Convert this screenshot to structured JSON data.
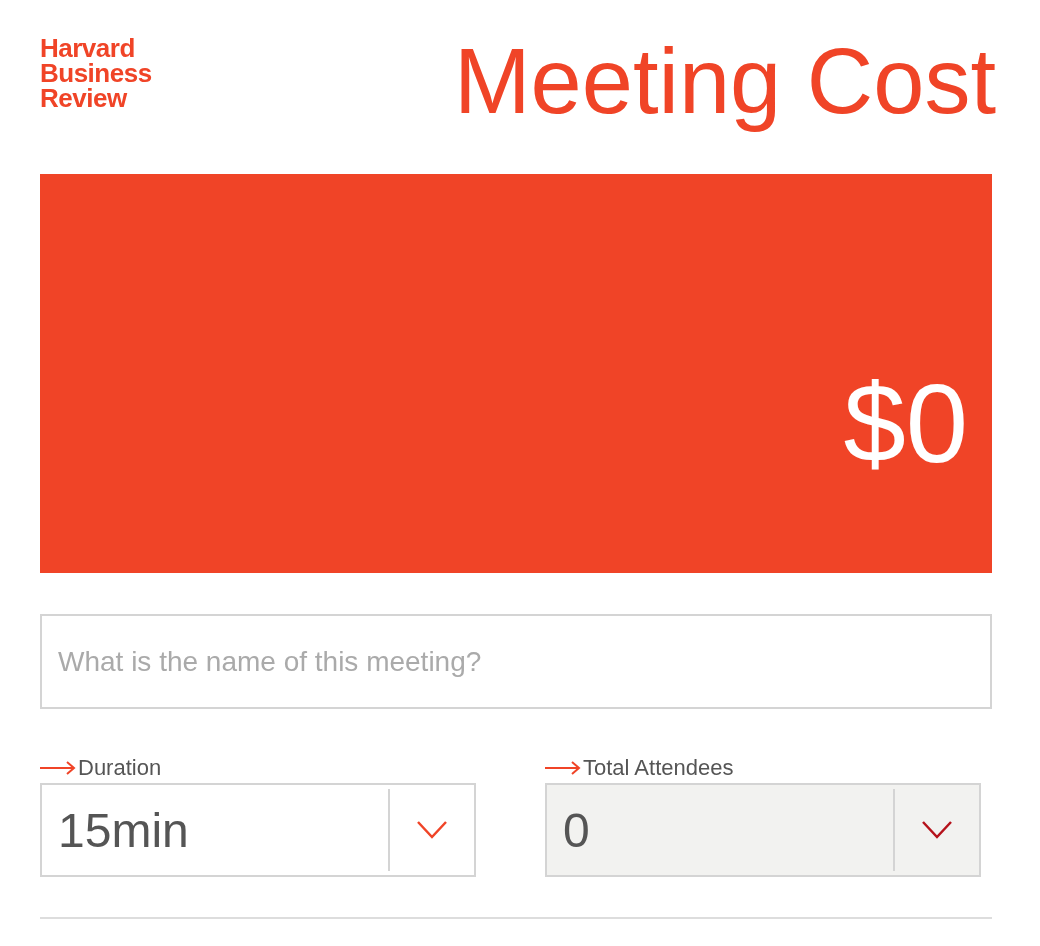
{
  "logo": {
    "lines": [
      "Harvard",
      "Business",
      "Review"
    ]
  },
  "title": "Meeting Cost",
  "cost": {
    "amount": "$0"
  },
  "meeting_name": {
    "placeholder": "What is the name of this meeting?"
  },
  "selects": [
    {
      "label": "Duration",
      "value": "15min",
      "focused": false
    },
    {
      "label": "Total Attendees",
      "value": "0",
      "focused": true
    }
  ]
}
